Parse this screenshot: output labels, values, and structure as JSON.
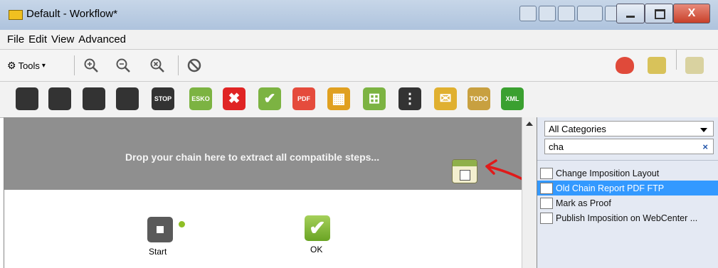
{
  "window": {
    "title": "Default - Workflow*",
    "app_icon": "esko-app-icon",
    "close_glyph": "X"
  },
  "menubar": {
    "items": [
      "File",
      "Edit",
      "View",
      "Advanced"
    ]
  },
  "toolbar": {
    "tools_label": "Tools",
    "tools_arrow": "▾"
  },
  "steps": [
    {
      "name": "tag-step-icon",
      "text": "",
      "color": "#333333"
    },
    {
      "name": "tag-edit-step-icon",
      "text": "",
      "color": "#333333"
    },
    {
      "name": "list-step-icon",
      "text": "",
      "color": "#333333"
    },
    {
      "name": "list-alt-step-icon",
      "text": "",
      "color": "#333333"
    },
    {
      "name": "stop-step-icon",
      "text": "STOP",
      "color": "#333333"
    },
    {
      "name": "esko-step-icon",
      "text": "ESKO",
      "color": "#7cb342"
    },
    {
      "name": "cancel-step-icon",
      "text": "✖",
      "color": "#e02424"
    },
    {
      "name": "ok-step-icon",
      "text": "✔",
      "color": "#7cb342"
    },
    {
      "name": "pdf-step-icon",
      "text": "PDF",
      "color": "#e54b3c"
    },
    {
      "name": "imposition-step-icon",
      "text": "▦",
      "color": "#e0a020"
    },
    {
      "name": "chain-step-icon",
      "text": "⊞",
      "color": "#7cb342"
    },
    {
      "name": "branch-step-icon",
      "text": "⋮",
      "color": "#333333"
    },
    {
      "name": "mail-step-icon",
      "text": "✉",
      "color": "#e0b030"
    },
    {
      "name": "todo-step-icon",
      "text": "TODO",
      "color": "#c8a040"
    },
    {
      "name": "xml-step-icon",
      "text": "XML",
      "color": "#3aa030"
    }
  ],
  "dropzone": {
    "text": "Drop your chain here to extract all compatible steps..."
  },
  "nodes": {
    "start_label": "Start",
    "ok_label": "OK"
  },
  "rpanel": {
    "category": "All Categories",
    "search": "cha",
    "clear": "×",
    "items": [
      {
        "label": "Change Imposition Layout",
        "selected": false
      },
      {
        "label": "Old Chain Report PDF FTP",
        "selected": true
      },
      {
        "label": "Mark as Proof",
        "selected": false
      },
      {
        "label": "Publish Imposition on WebCenter ...",
        "selected": false
      }
    ]
  }
}
